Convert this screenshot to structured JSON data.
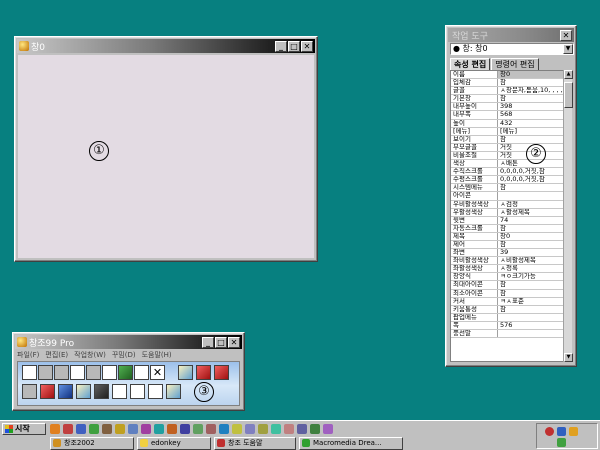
{
  "form_window": {
    "title": "창0",
    "callout": "①"
  },
  "property_window": {
    "title": "작업 도구",
    "object_select": "● 창: 창0",
    "tabs": [
      {
        "label": "속성 편집",
        "active": true
      },
      {
        "label": "명령어 편집",
        "active": false
      }
    ],
    "callout": "②",
    "properties": [
      {
        "name": "이름",
        "value": "창0"
      },
      {
        "name": "입체감",
        "value": "참"
      },
      {
        "name": "글꼴",
        "value": "ㅅ창문자,돋움,10, , , ,"
      },
      {
        "name": "기본창",
        "value": "참"
      },
      {
        "name": "내부높이",
        "value": "398"
      },
      {
        "name": "내부폭",
        "value": "568"
      },
      {
        "name": "높이",
        "value": "432"
      },
      {
        "name": "[메뉴]",
        "value": "[메뉴]"
      },
      {
        "name": "보이기",
        "value": "참"
      },
      {
        "name": "부모글꼴",
        "value": "거짓"
      },
      {
        "name": "비율조절",
        "value": "거짓"
      },
      {
        "name": "색상",
        "value": "ㅅ배톤"
      },
      {
        "name": "수직스크롤",
        "value": "0,0,0,0,거짓,참"
      },
      {
        "name": "수평스크롤",
        "value": "0,0,0,0,거짓,참"
      },
      {
        "name": "시스템메뉴",
        "value": "참"
      },
      {
        "name": "아이콘",
        "value": ""
      },
      {
        "name": "우비활성색상",
        "value": "ㅅ검정"
      },
      {
        "name": "우활성색상",
        "value": "ㅅ활성제목"
      },
      {
        "name": "윗변",
        "value": "74"
      },
      {
        "name": "자동스크롤",
        "value": "참"
      },
      {
        "name": "제목",
        "value": "창0"
      },
      {
        "name": "제어",
        "value": "참"
      },
      {
        "name": "좌변",
        "value": "39"
      },
      {
        "name": "좌비활성색상",
        "value": "ㅅ비활성제목"
      },
      {
        "name": "좌활성색상",
        "value": "ㅅ청록"
      },
      {
        "name": "창양식",
        "value": "ㅋㅇ크기가능"
      },
      {
        "name": "최대아이콘",
        "value": "참"
      },
      {
        "name": "최소아이콘",
        "value": "참"
      },
      {
        "name": "커서",
        "value": "ㅋㅅ표준"
      },
      {
        "name": "키움통성",
        "value": "참"
      },
      {
        "name": "팝업메뉴",
        "value": ""
      },
      {
        "name": "폭",
        "value": "576"
      },
      {
        "name": "풍선말",
        "value": ""
      }
    ]
  },
  "main_window": {
    "title": "창조99 Pro",
    "menu": [
      "파일(F)",
      "편집(E)",
      "작업창(W)",
      "꾸밈(D)",
      "도움말(H)"
    ],
    "callout": "③"
  },
  "taskbar": {
    "start_label": "시작",
    "tasks": [
      {
        "label": "창조2002",
        "icon_color": "#d09020"
      },
      {
        "label": "edonkey",
        "icon_color": "#f0d040"
      },
      {
        "label": "창조 도움말",
        "icon_color": "#c03030"
      },
      {
        "label": "Macromedia Drea...",
        "icon_color": "#30a030"
      }
    ],
    "quick_launch_colors": [
      "#e08020",
      "#c04040",
      "#4060c0",
      "#40a040",
      "#806040",
      "#c0a020",
      "#6080c0",
      "#a040a0",
      "#20a0a0",
      "#c06020",
      "#4040a0",
      "#60a060",
      "#a06060",
      "#2080c0",
      "#c0c040",
      "#8080c0",
      "#a0a040",
      "#40c0a0",
      "#c08080",
      "#6060a0",
      "#408040",
      "#a060c0"
    ]
  }
}
